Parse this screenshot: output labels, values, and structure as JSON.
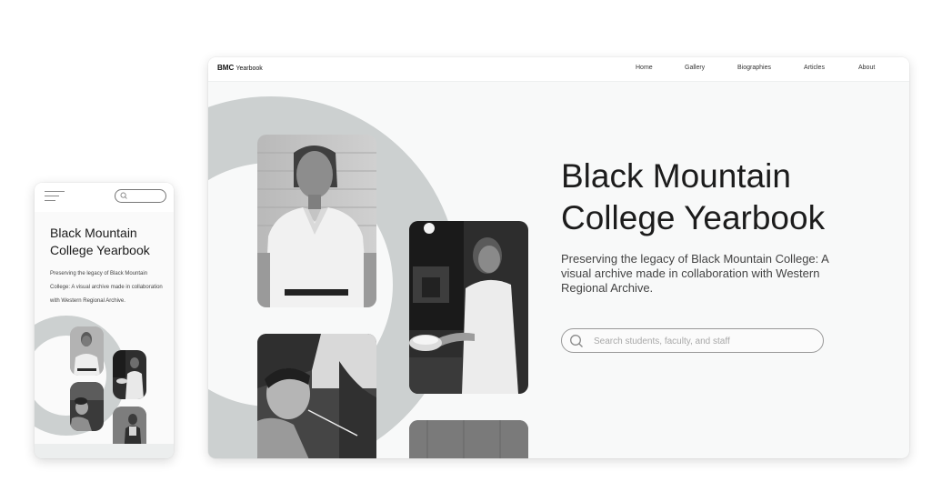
{
  "mobile": {
    "title": "Black Mountain College Yearbook",
    "description": "Preserving the legacy of Black Mountain College: A visual archive made in collaboration with Western Regional Archive."
  },
  "desktop": {
    "logo": {
      "bold": "BMC",
      "rest": "Yearbook"
    },
    "nav": [
      "Home",
      "Gallery",
      "Biographies",
      "Articles",
      "About"
    ],
    "title": "Black Mountain College Yearbook",
    "description": "Preserving the legacy of Black Mountain College: A visual archive made in collaboration with Western Regional Archive.",
    "search": {
      "placeholder": "Search students, faculty, and staff"
    }
  },
  "icons": {
    "menu": "hamburger-icon",
    "search": "search-icon"
  },
  "colors": {
    "ring": "#ccd0d0",
    "page_bg": "#f8f9f9",
    "text": "#1c1c1c"
  }
}
